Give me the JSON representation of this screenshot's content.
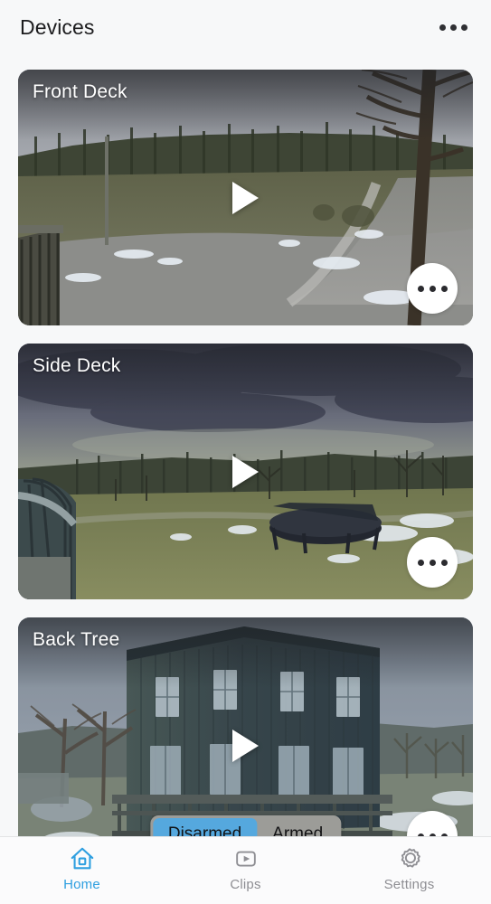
{
  "header": {
    "title": "Devices",
    "overflow_icon": "more-horizontal-icon"
  },
  "colors": {
    "accent_blue": "#2e9fe0",
    "segment_selected": "#55a8de",
    "segment_track": "#9c9c98",
    "background": "#f7f8f9",
    "inactive_text": "#8e8e93"
  },
  "cameras": [
    {
      "name": "Front Deck",
      "play_icon": "play-icon",
      "more_icon": "more-horizontal-icon",
      "scene": "rural-driveway-with-bare-trees-and-snow-patches"
    },
    {
      "name": "Side Deck",
      "play_icon": "play-icon",
      "more_icon": "more-horizontal-icon",
      "scene": "overcast-lawn-with-trampoline-and-snow"
    },
    {
      "name": "Back Tree",
      "play_icon": "play-icon",
      "more_icon": "more-horizontal-icon",
      "scene": "dark-green-two-story-house-with-deck"
    }
  ],
  "arm_control": {
    "options": [
      {
        "label": "Disarmed",
        "selected": true
      },
      {
        "label": "Armed",
        "selected": false
      }
    ]
  },
  "tabbar": {
    "items": [
      {
        "label": "Home",
        "icon": "home-icon",
        "active": true
      },
      {
        "label": "Clips",
        "icon": "clips-icon",
        "active": false
      },
      {
        "label": "Settings",
        "icon": "settings-gear-icon",
        "active": false
      }
    ]
  }
}
